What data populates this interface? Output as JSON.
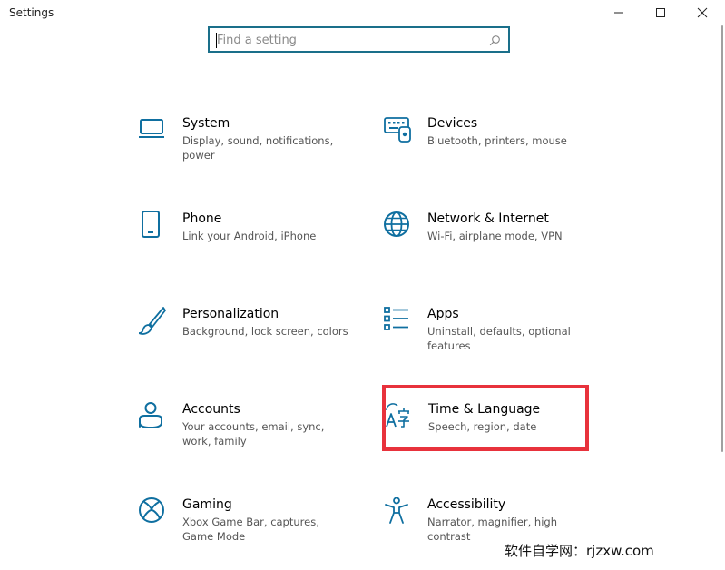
{
  "window": {
    "title": "Settings",
    "minimize_icon": "minimize-icon",
    "maximize_icon": "maximize-icon",
    "close_icon": "close-icon"
  },
  "search": {
    "placeholder": "Find a setting",
    "value": "",
    "icon": "search-icon"
  },
  "categories": [
    {
      "key": "system",
      "title": "System",
      "description": "Display, sound, notifications, power",
      "icon": "monitor-icon"
    },
    {
      "key": "devices",
      "title": "Devices",
      "description": "Bluetooth, printers, mouse",
      "icon": "keyboard-devices-icon"
    },
    {
      "key": "phone",
      "title": "Phone",
      "description": "Link your Android, iPhone",
      "icon": "phone-icon"
    },
    {
      "key": "network",
      "title": "Network & Internet",
      "description": "Wi-Fi, airplane mode, VPN",
      "icon": "globe-icon"
    },
    {
      "key": "personalization",
      "title": "Personalization",
      "description": "Background, lock screen, colors",
      "icon": "brush-icon"
    },
    {
      "key": "apps",
      "title": "Apps",
      "description": "Uninstall, defaults, optional features",
      "icon": "apps-list-icon"
    },
    {
      "key": "accounts",
      "title": "Accounts",
      "description": "Your accounts, email, sync, work, family",
      "icon": "person-icon"
    },
    {
      "key": "time-language",
      "title": "Time & Language",
      "description": "Speech, region, date",
      "icon": "language-icon"
    },
    {
      "key": "gaming",
      "title": "Gaming",
      "description": "Xbox Game Bar, captures, Game Mode",
      "icon": "xbox-icon"
    },
    {
      "key": "accessibility",
      "title": "Accessibility",
      "description": "Narrator, magnifier, high contrast",
      "icon": "accessibility-icon"
    }
  ],
  "colors": {
    "icon_blue": "#0f6fa0",
    "highlight_red": "#e8323c"
  },
  "watermark": "软件自学网：rjzxw.com"
}
